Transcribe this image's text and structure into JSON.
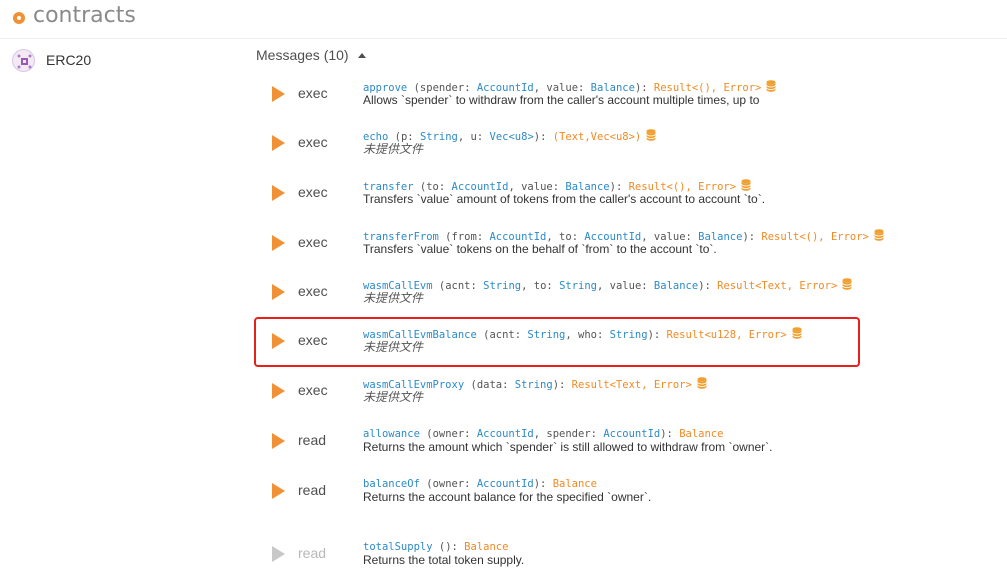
{
  "app": {
    "title": "contracts"
  },
  "contract": {
    "name": "ERC20"
  },
  "messages": {
    "header": "Messages (10)",
    "items": [
      {
        "kind": "exec",
        "name": "approve",
        "params": [
          [
            "spender",
            "AccountId"
          ],
          [
            "value",
            "Balance"
          ]
        ],
        "ret": "Result<(), Error>",
        "doc": "Allows `spender` to withdraw from the caller's account multiple times, up to",
        "db": true
      },
      {
        "kind": "exec",
        "name": "echo",
        "params": [
          [
            "p",
            "String"
          ],
          [
            "u",
            "Vec<u8>"
          ]
        ],
        "ret": "(Text,Vec<u8>)",
        "doc": "未提供文件",
        "db": true
      },
      {
        "kind": "exec",
        "name": "transfer",
        "params": [
          [
            "to",
            "AccountId"
          ],
          [
            "value",
            "Balance"
          ]
        ],
        "ret": "Result<(), Error>",
        "doc": "Transfers `value` amount of tokens from the caller's account to account `to`.",
        "db": true
      },
      {
        "kind": "exec",
        "name": "transferFrom",
        "params": [
          [
            "from",
            "AccountId"
          ],
          [
            "to",
            "AccountId"
          ],
          [
            "value",
            "Balance"
          ]
        ],
        "ret": "Result<(), Error>",
        "doc": "Transfers `value` tokens on the behalf of `from` to the account `to`.",
        "db": true
      },
      {
        "kind": "exec",
        "name": "wasmCallEvm",
        "params": [
          [
            "acnt",
            "String"
          ],
          [
            "to",
            "String"
          ],
          [
            "value",
            "Balance"
          ]
        ],
        "ret": "Result<Text, Error>",
        "doc": "未提供文件",
        "db": true
      },
      {
        "kind": "exec",
        "name": "wasmCallEvmBalance",
        "params": [
          [
            "acnt",
            "String"
          ],
          [
            "who",
            "String"
          ]
        ],
        "ret": "Result<u128, Error>",
        "doc": "未提供文件",
        "db": true
      },
      {
        "kind": "exec",
        "name": "wasmCallEvmProxy",
        "params": [
          [
            "data",
            "String"
          ]
        ],
        "ret": "Result<Text, Error>",
        "doc": "未提供文件",
        "db": true
      },
      {
        "kind": "read",
        "name": "allowance",
        "params": [
          [
            "owner",
            "AccountId"
          ],
          [
            "spender",
            "AccountId"
          ]
        ],
        "ret": "Balance",
        "doc": "Returns the amount which `spender` is still allowed to withdraw from `owner`.",
        "db": false
      },
      {
        "kind": "read",
        "name": "balanceOf",
        "params": [
          [
            "owner",
            "AccountId"
          ]
        ],
        "ret": "Balance",
        "doc": "Returns the account balance for the specified `owner`.",
        "db": false
      },
      {
        "kind": "read",
        "name": "totalSupply",
        "params": [],
        "ret": "Balance",
        "doc": "Returns the total token supply.",
        "db": false,
        "disabled": true
      }
    ]
  },
  "colors": {
    "accent": "#f19135",
    "type": "#2d8ac7",
    "return": "#f08a24",
    "highlight": "#e8201a"
  },
  "no_doc_text": "未提供文件"
}
